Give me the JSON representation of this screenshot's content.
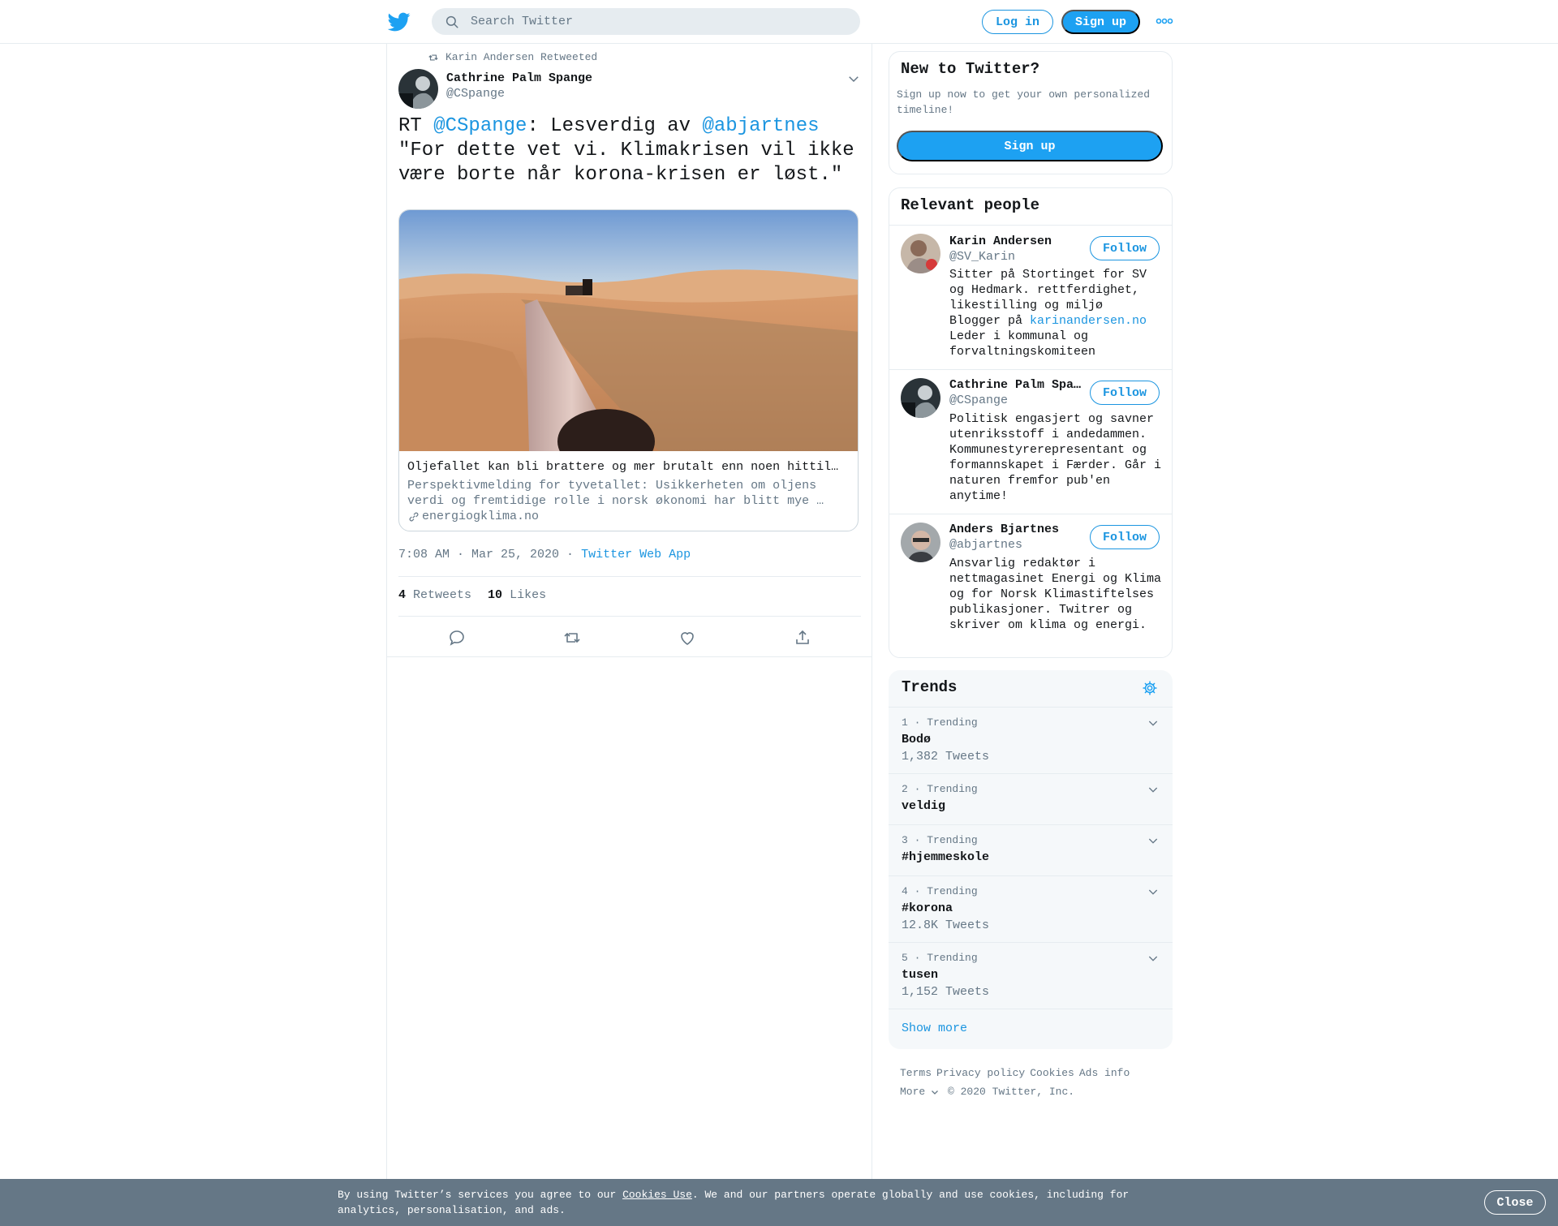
{
  "header": {
    "search_placeholder": "Search Twitter",
    "login_label": "Log in",
    "signup_label": "Sign up"
  },
  "tweet": {
    "retweeted_by": "Karin Andersen Retweeted",
    "author_name": "Cathrine Palm Spange",
    "author_handle": "@CSpange",
    "text_prefix": "RT ",
    "mention_1": "@CSpange",
    "text_middle": ": Lesverdig av ",
    "mention_2": "@abjartnes",
    "text_rest": "\"For dette vet vi. Klimakrisen vil ikke være borte når korona-krisen er løst.\"",
    "card": {
      "title": "Oljefallet kan bli brattere og mer brutalt enn noen hittil har trodd",
      "description": "Perspektivmelding for tyvetallet: Usikkerheten om oljens verdi og fremtidige rolle i norsk økonomi har blitt mye …",
      "domain": "energiogklima.no"
    },
    "timestamp": "7:08 AM · Mar 25, 2020",
    "source_sep": " · ",
    "source": "Twitter Web App",
    "retweet_count": "4",
    "retweet_label": "Retweets",
    "like_count": "10",
    "like_label": "Likes"
  },
  "new_to_twitter": {
    "title": "New to Twitter?",
    "description": "Sign up now to get your own personalized timeline!",
    "button": "Sign up"
  },
  "relevant_people": {
    "title": "Relevant people",
    "follow_label": "Follow",
    "people": [
      {
        "name": "Karin Andersen",
        "handle": "@SV_Karin",
        "bio_1": "Sitter på Stortinget for SV og Hedmark. rettferdighet, likestilling og miljø\nBlogger på ",
        "bio_link": "karinandersen.no",
        "bio_2": "\nLeder i kommunal og forvaltningskomiteen"
      },
      {
        "name": "Cathrine Palm Spange",
        "handle": "@CSpange",
        "bio": "Politisk engasjert og savner utenriksstoff i andedammen. Kommunestyrerepresentant og formannskapet i Færder. Går i naturen fremfor pub'en anytime!"
      },
      {
        "name": "Anders Bjartnes",
        "handle": "@abjartnes",
        "bio": "Ansvarlig redaktør i nettmagasinet Energi og Klima og for Norsk Klimastiftelses publikasjoner. Twitrer og skriver om klima og energi."
      }
    ]
  },
  "trends": {
    "title": "Trends",
    "items": [
      {
        "meta": "1 · Trending",
        "name": "Bodø",
        "count": "1,382 Tweets"
      },
      {
        "meta": "2 · Trending",
        "name": "veldig",
        "count": ""
      },
      {
        "meta": "3 · Trending",
        "name": "#hjemmeskole",
        "count": ""
      },
      {
        "meta": "4 · Trending",
        "name": "#korona",
        "count": "12.8K Tweets"
      },
      {
        "meta": "5 · Trending",
        "name": "tusen",
        "count": "1,152 Tweets"
      }
    ],
    "show_more": "Show more"
  },
  "footer": {
    "links": [
      "Terms",
      "Privacy policy",
      "Cookies",
      "Ads info"
    ],
    "more": "More",
    "copyright": "© 2020 Twitter, Inc."
  },
  "cookie_banner": {
    "text_1": "By using Twitter’s services you agree to our ",
    "link": "Cookies Use",
    "text_2": ". We and our partners operate globally and use cookies, including for analytics, personalisation, and ads.",
    "close": "Close"
  },
  "colors": {
    "brand": "#1da1f2",
    "link": "#1b95e0",
    "secondary_text": "#657786",
    "border": "#e6ecf0",
    "cookie_bg": "#657786"
  },
  "icons": [
    "twitter-logo-icon",
    "search-icon",
    "more-icon",
    "retweet-icon",
    "chevron-down-icon",
    "reply-icon",
    "like-icon",
    "share-icon",
    "link-icon",
    "gear-icon"
  ]
}
